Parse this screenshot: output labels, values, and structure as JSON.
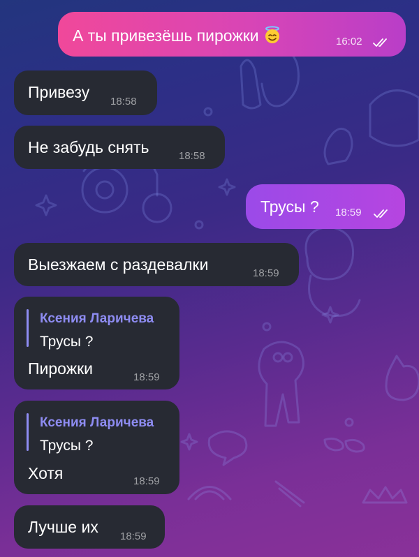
{
  "messages": [
    {
      "direction": "outgoing",
      "text": "А ты привезёшь пирожки",
      "emoji": "smiling-face-with-halo",
      "time": "16:02",
      "read": true
    },
    {
      "direction": "incoming",
      "text": "Привезу",
      "time": "18:58"
    },
    {
      "direction": "incoming",
      "text": "Не забудь снять",
      "time": "18:58"
    },
    {
      "direction": "outgoing",
      "text": "Трусы ?",
      "time": "18:59",
      "read": true
    },
    {
      "direction": "incoming",
      "text": "Выезжаем с раздевалки",
      "time": "18:59"
    },
    {
      "direction": "incoming",
      "reply": {
        "author": "Ксения Ларичева",
        "quote": "Трусы ?"
      },
      "text": "Пирожки",
      "time": "18:59"
    },
    {
      "direction": "incoming",
      "reply": {
        "author": "Ксения Ларичева",
        "quote": "Трусы ?"
      },
      "text": "Хотя",
      "time": "18:59"
    },
    {
      "direction": "incoming",
      "text": "Лучше их",
      "time": "18:59"
    }
  ],
  "colors": {
    "outgoing_gradient_start": "#f0489a",
    "outgoing_gradient_end": "#b93ec8",
    "outgoing_purple_start": "#9b4ae8",
    "outgoing_purple_end": "#b645e0",
    "incoming_bubble": "#272a33",
    "reply_accent": "#8e8cf2",
    "background_top": "#23357e",
    "background_bottom": "#8a3199"
  }
}
